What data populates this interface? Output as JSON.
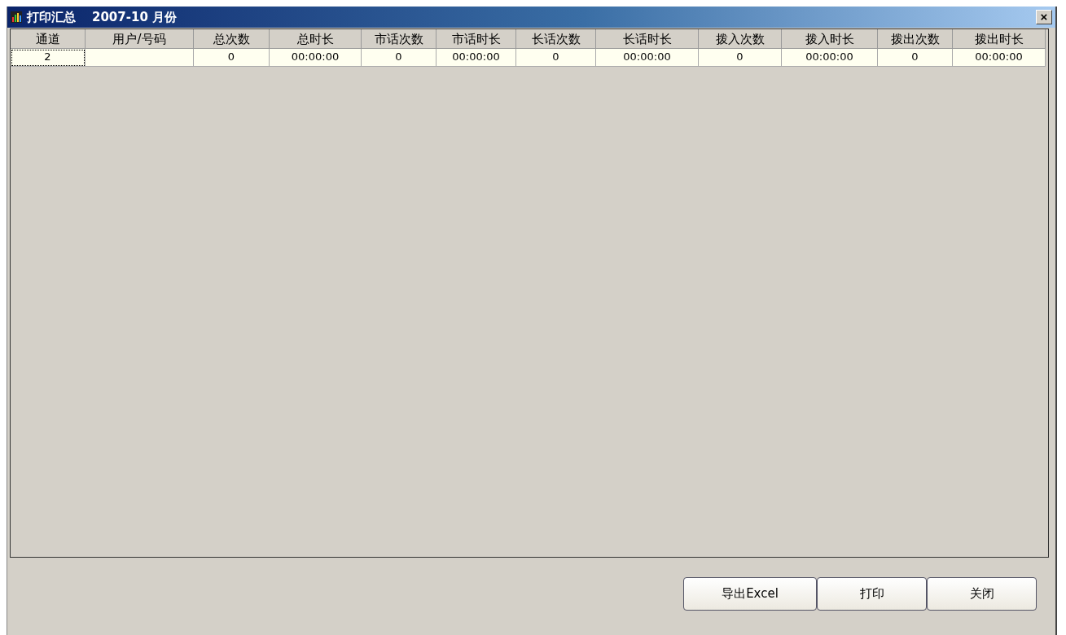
{
  "window": {
    "title": "打印汇总",
    "period": "2007-10 月份",
    "close": "×"
  },
  "table": {
    "columns": [
      "通道",
      "用户/号码",
      "总次数",
      "总时长",
      "市话次数",
      "市话时长",
      "长话次数",
      "长话时长",
      "拨入次数",
      "拨入时长",
      "拨出次数",
      "拨出时长"
    ],
    "rows": [
      {
        "cells": [
          {
            "text": "2",
            "focused": true
          },
          {
            "focused": false
          },
          {
            "text": "0",
            "focused": false
          },
          {
            "text": "00:00:00",
            "focused": false
          },
          {
            "text": "0",
            "focused": false
          },
          {
            "text": "00:00:00",
            "focused": false
          },
          {
            "text": "0",
            "focused": false
          },
          {
            "text": "00:00:00",
            "focused": false
          },
          {
            "text": "0",
            "focused": false
          },
          {
            "text": "00:00:00",
            "focused": false
          },
          {
            "text": "0",
            "focused": false
          },
          {
            "text": "00:00:00",
            "focused": false
          }
        ]
      }
    ]
  },
  "buttons": [
    "导出Excel",
    "打印",
    "关闭"
  ]
}
